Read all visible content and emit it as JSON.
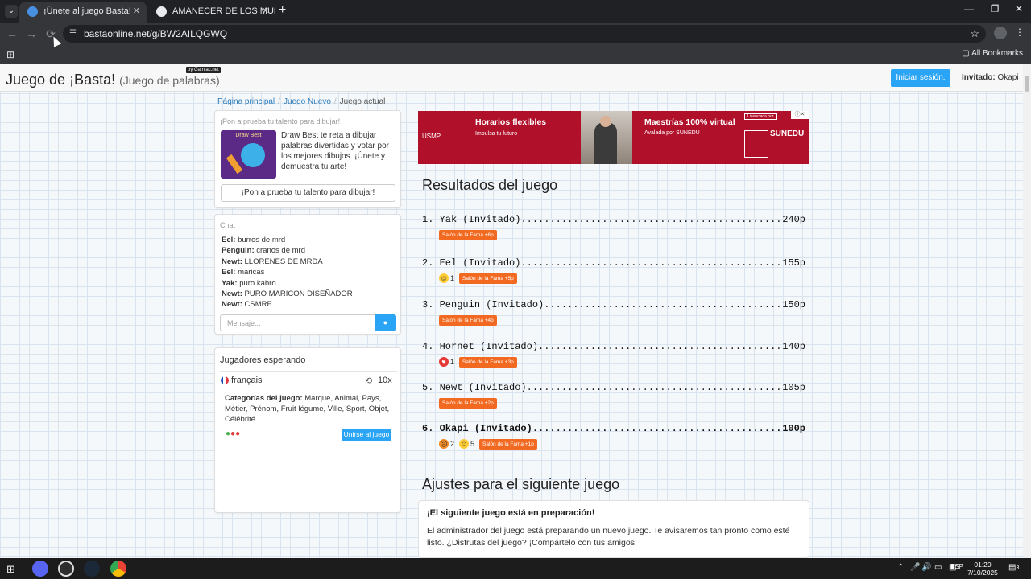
{
  "browser": {
    "tabs": [
      {
        "title": "¡Únete al juego Basta!",
        "active": true
      },
      {
        "title": "AMANECER DE LOS MUERTOS",
        "active": false
      }
    ],
    "url": "bastaonline.net/g/BW2AILQGWQ",
    "all_bookmarks": "All Bookmarks"
  },
  "header": {
    "brand": "Juego de ¡Basta!",
    "subtitle": "(Juego de palabras)",
    "byline": "by Gamiac.net",
    "login_label": "Iniciar sesión.",
    "guest_label": "Invitado:",
    "guest_name": "Okapi"
  },
  "breadcrumb": [
    "Página principal",
    "Juego Nuevo",
    "Juego actual"
  ],
  "promo": {
    "heading": "¡Pon a prueba tu talento para dibujar!",
    "image_title": "Draw Best",
    "text": "Draw Best te reta a dibujar palabras divertidas y votar por los mejores dibujos. ¡Únete y demuestra tu arte!",
    "button": "¡Pon a prueba tu talento para dibujar!"
  },
  "chat": {
    "heading": "Chat",
    "messages": [
      {
        "user": "Eel:",
        "text": "burros de mrd"
      },
      {
        "user": "Penguin:",
        "text": "cranos de mrd"
      },
      {
        "user": "Newt:",
        "text": "LLORENES DE MRDA"
      },
      {
        "user": "Eel:",
        "text": "maricas"
      },
      {
        "user": "Yak:",
        "text": "puro kabro"
      },
      {
        "user": "Newt:",
        "text": "PURO MARICON DISEÑADOR"
      },
      {
        "user": "Newt:",
        "text": "CSMRE"
      }
    ],
    "placeholder": "Mensaje..."
  },
  "waiting": {
    "heading": "Jugadores esperando",
    "language": "français",
    "rounds": "10x",
    "categories_label": "Categorías del juego:",
    "categories": "Marque, Animal, Pays, Métier, Prénom, Fruit légume, Ville, Sport, Objet, Célébrité",
    "join_label": "Unirse al juego"
  },
  "ad": {
    "logo": "USMP",
    "headline1": "Horarios flexibles",
    "sub1": "Impulsa tu futuro",
    "headline2": "Maestrías 100% virtual",
    "sub2": "Avalada por SUNEDU",
    "brand2": "SUNEDU",
    "badge": "Licenciada por"
  },
  "results": {
    "title": "Resultados del juego",
    "rows": [
      {
        "rank": "1.",
        "name": "Yak (Invitado)",
        "points": "240p",
        "fame": "Salón de la Fama +6p",
        "reactions": []
      },
      {
        "rank": "2.",
        "name": "Eel (Invitado)",
        "points": "155p",
        "fame": "Salón de la Fama +5p",
        "reactions": [
          {
            "icon": "laugh",
            "count": "1"
          }
        ]
      },
      {
        "rank": "3.",
        "name": "Penguin (Invitado)",
        "points": "150p",
        "fame": "Salón de la Fama +4p",
        "reactions": []
      },
      {
        "rank": "4.",
        "name": "Hornet (Invitado)",
        "points": "140p",
        "fame": "Salón de la Fama +3p",
        "reactions": [
          {
            "icon": "heart",
            "count": "1"
          }
        ]
      },
      {
        "rank": "5.",
        "name": "Newt (Invitado)",
        "points": "105p",
        "fame": "Salón de la Fama +2p",
        "reactions": []
      },
      {
        "rank": "6.",
        "name": "Okapi (Invitado)",
        "points": "100p",
        "fame": "Salón de la Fama +1p",
        "reactions": [
          {
            "icon": "angry",
            "count": "2"
          },
          {
            "icon": "laugh",
            "count": "5"
          }
        ]
      }
    ]
  },
  "settings": {
    "title": "Ajustes para el siguiente juego",
    "prep_title": "¡El siguiente juego está en preparación!",
    "prep_text": "El administrador del juego está preparando un nuevo juego. Te avisaremos tan pronto como esté listo. ¿Disfrutas del juego? ¡Compártelo con tus amigos!"
  },
  "taskbar": {
    "lang": "ESP",
    "time": "01:20",
    "date": "7/10/2025",
    "notifications": "3"
  },
  "colors": {
    "accent": "#2aa4f4",
    "fame": "#f26a21",
    "ad": "#b0102a"
  }
}
